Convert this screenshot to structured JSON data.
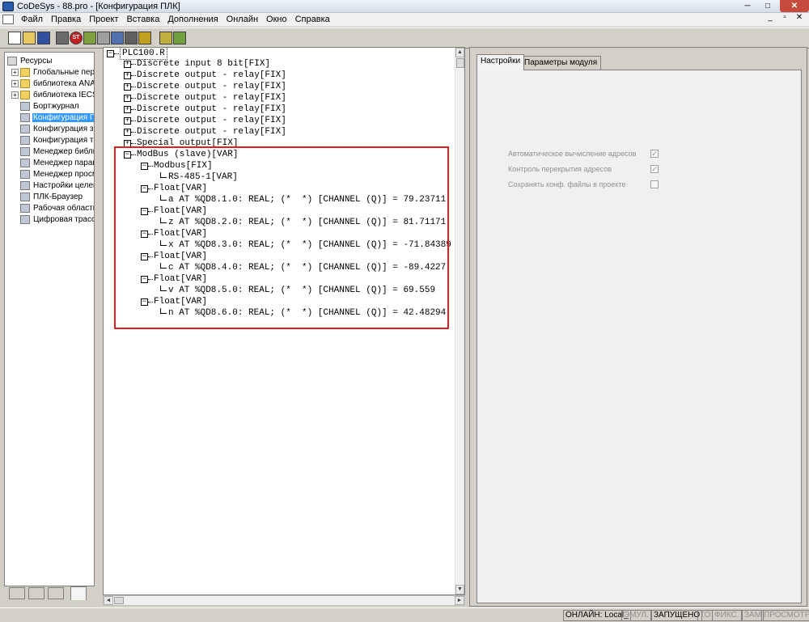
{
  "window": {
    "title": "CoDeSys - 88.pro - [Конфигурация ПЛК]",
    "min_glyph": "─",
    "max_glyph": "□",
    "close_glyph": "✕"
  },
  "menu": {
    "items": [
      "Файл",
      "Правка",
      "Проект",
      "Вставка",
      "Дополнения",
      "Онлайн",
      "Окно",
      "Справка"
    ],
    "mdi_min": "_",
    "mdi_restore": "▫",
    "mdi_close": "✕"
  },
  "toolbar": {
    "stop_label": "ST"
  },
  "resources": {
    "items": [
      {
        "label": "Ресурсы",
        "exp": "",
        "icon": "res"
      },
      {
        "label": "Глобальные перем",
        "exp": "+",
        "icon": "folder"
      },
      {
        "label": "библиотека ANALY",
        "exp": "+",
        "icon": "folder"
      },
      {
        "label": "библиотека IECSFI",
        "exp": "+",
        "icon": "folder"
      },
      {
        "label": "Бортжурнал",
        "exp": "",
        "icon": "tool"
      },
      {
        "label": "Конфигурация ПЛК",
        "exp": "",
        "icon": "tool",
        "selected": true
      },
      {
        "label": "Конфигурация зад",
        "exp": "",
        "icon": "tool"
      },
      {
        "label": "Конфигурация тре",
        "exp": "",
        "icon": "tool"
      },
      {
        "label": "Менеджер библио",
        "exp": "",
        "icon": "tool"
      },
      {
        "label": "Менеджер параме",
        "exp": "",
        "icon": "tool"
      },
      {
        "label": "Менеджер просмо",
        "exp": "",
        "icon": "tool"
      },
      {
        "label": "Настройки целево",
        "exp": "",
        "icon": "tool"
      },
      {
        "label": "ПЛК-Браузер",
        "exp": "",
        "icon": "tool"
      },
      {
        "label": "Рабочая область",
        "exp": "",
        "icon": "tool"
      },
      {
        "label": "Цифровая трассир",
        "exp": "",
        "icon": "tool"
      }
    ]
  },
  "tree": {
    "root": "PLC100.R",
    "expand_glyph": "+",
    "collapse_glyph": "−",
    "modules": [
      "Discrete input 8 bit[FIX]",
      "Discrete output - relay[FIX]",
      "Discrete output - relay[FIX]",
      "Discrete output - relay[FIX]",
      "Discrete output - relay[FIX]",
      "Discrete output - relay[FIX]",
      "Discrete output - relay[FIX]",
      "Special output[FIX]"
    ],
    "modbus": {
      "label": "ModBus (slave)[VAR]",
      "child": "Modbus[FIX]",
      "port": "RS-485-1[VAR]",
      "floats": [
        {
          "label": "Float[VAR]",
          "var": "a AT %QD8.1.0: REAL; (*  *) [CHANNEL (Q)] = 79.23711"
        },
        {
          "label": "Float[VAR]",
          "var": "z AT %QD8.2.0: REAL; (*  *) [CHANNEL (Q)] = 81.71171"
        },
        {
          "label": "Float[VAR]",
          "var": "x AT %QD8.3.0: REAL; (*  *) [CHANNEL (Q)] = -71.84389"
        },
        {
          "label": "Float[VAR]",
          "var": "c AT %QD8.4.0: REAL; (*  *) [CHANNEL (Q)] = -89.4227"
        },
        {
          "label": "Float[VAR]",
          "var": "v AT %QD8.5.0: REAL; (*  *) [CHANNEL (Q)] = 69.559"
        },
        {
          "label": "Float[VAR]",
          "var": "n AT %QD8.6.0: REAL; (*  *) [CHANNEL (Q)] = 42.48294"
        }
      ]
    }
  },
  "settings": {
    "tabs": [
      "Настройки",
      "Параметры модуля"
    ],
    "options": [
      {
        "label": "Автоматическое вычисление адресов",
        "checked": true
      },
      {
        "label": "Контроль перекрытия адресов",
        "checked": true
      },
      {
        "label": "Сохранять конф. файлы в проекте",
        "checked": false
      }
    ],
    "check_glyph": "✓"
  },
  "statusbar": {
    "online": "ОНЛАЙН: Local_",
    "emul": "ЭМУЛ.",
    "running": "ЗАПУЩЕНО",
    "to": "ТО",
    "fix": "ФИКС.",
    "zam": "ЗАМ",
    "view": "ПРОСМОТР"
  },
  "colors": {
    "highlight": "#e02020",
    "selection": "#3399ff"
  }
}
